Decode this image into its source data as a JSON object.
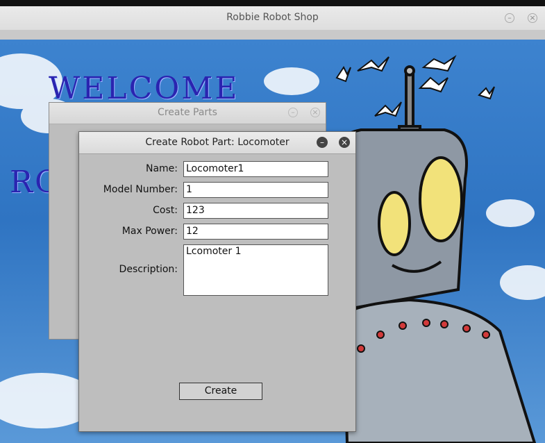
{
  "main_window": {
    "title": "Robbie Robot Shop"
  },
  "background": {
    "welcome_text": "WELCOME",
    "partial_text": "RO"
  },
  "create_parts_window": {
    "title": "Create Parts"
  },
  "dialog": {
    "title": "Create Robot Part: Locomoter",
    "fields": {
      "name": {
        "label": "Name:",
        "value": "Locomoter1"
      },
      "model_number": {
        "label": "Model Number:",
        "value": "1"
      },
      "cost": {
        "label": "Cost:",
        "value": "123"
      },
      "max_power": {
        "label": "Max Power:",
        "value": "12"
      },
      "description": {
        "label": "Description:",
        "value": "Lcomoter 1"
      }
    },
    "create_label": "Create"
  },
  "colors": {
    "welcome": "#2a24b0",
    "sky": "#2f74c2",
    "dialog_bg": "#bebebe"
  }
}
